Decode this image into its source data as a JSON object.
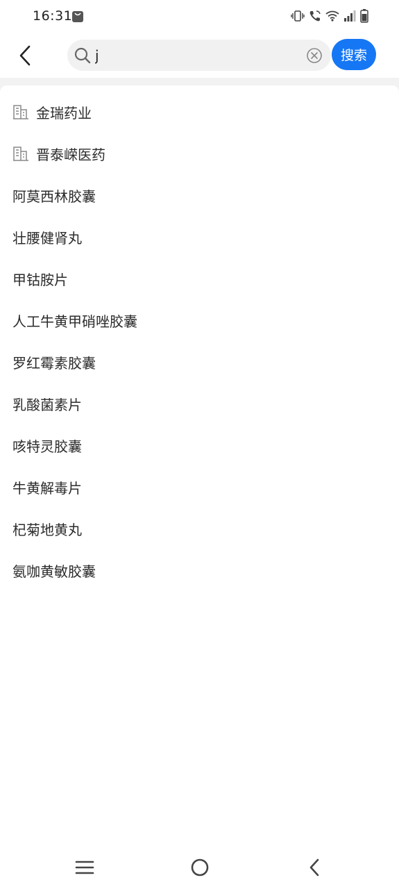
{
  "status_bar": {
    "time": "16:31",
    "icons": [
      "shopping-bag-icon",
      "vibrate-icon",
      "wifi-call-icon",
      "wifi-icon",
      "signal-icon",
      "battery-icon"
    ]
  },
  "header": {
    "back_icon": "back-arrow-icon",
    "search": {
      "value": "j",
      "placeholder": "",
      "search_icon": "search-icon",
      "clear_icon": "clear-icon"
    },
    "search_button_label": "搜索",
    "accent_color": "#1677f5"
  },
  "suggestions": [
    {
      "label": "金瑞药业",
      "type": "company",
      "icon": "company-building-icon"
    },
    {
      "label": "晋泰嵘医药",
      "type": "company",
      "icon": "company-building-icon"
    },
    {
      "label": "阿莫西林胶囊",
      "type": "drug"
    },
    {
      "label": "壮腰健肾丸",
      "type": "drug"
    },
    {
      "label": "甲钴胺片",
      "type": "drug"
    },
    {
      "label": "人工牛黄甲硝唑胶囊",
      "type": "drug"
    },
    {
      "label": "罗红霉素胶囊",
      "type": "drug"
    },
    {
      "label": "乳酸菌素片",
      "type": "drug"
    },
    {
      "label": "咳特灵胶囊",
      "type": "drug"
    },
    {
      "label": "牛黄解毒片",
      "type": "drug"
    },
    {
      "label": "杞菊地黄丸",
      "type": "drug"
    },
    {
      "label": "氨咖黄敏胶囊",
      "type": "drug"
    }
  ],
  "nav_bar": {
    "items": [
      "menu-icon",
      "home-icon",
      "back-icon"
    ]
  }
}
